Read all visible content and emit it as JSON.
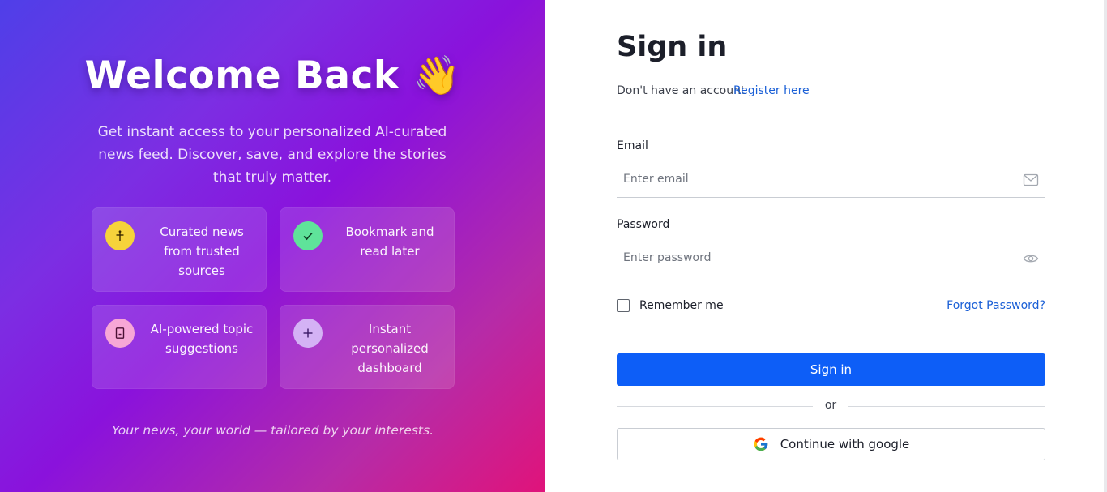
{
  "hero": {
    "title": "Welcome Back 👋",
    "subtitle": "Get instant access to your personalized AI-curated news feed. Discover, save, and explore the stories that truly matter.",
    "features": [
      {
        "label": "Curated news from trusted sources",
        "icon": "anchor-icon",
        "color": "#f6d33b"
      },
      {
        "label": "Bookmark and read later",
        "icon": "check-icon",
        "color": "#5fe39a"
      },
      {
        "label": "AI-powered topic suggestions",
        "icon": "book-icon",
        "color": "#f7a7d6"
      },
      {
        "label": "Instant personalized dashboard",
        "icon": "plus-icon",
        "color": "#d4b2f5"
      }
    ],
    "tagline": "Your news, your world — tailored by your interests."
  },
  "form": {
    "title": "Sign in",
    "no_account_text": "Don't have an account",
    "register_link": "Register here",
    "email_label": "Email",
    "email_placeholder": "Enter email",
    "email_value": "",
    "password_label": "Password",
    "password_placeholder": "Enter password",
    "password_value": "",
    "remember_label": "Remember me",
    "remember_checked": false,
    "forgot_link": "Forgot Password?",
    "submit_label": "Sign in",
    "or_text": "or",
    "google_label": "Continue with google"
  },
  "colors": {
    "primary": "#0d5ef7",
    "link": "#1a5fd6",
    "gradient_start": "#4f3fe8",
    "gradient_end": "#e0137a"
  }
}
